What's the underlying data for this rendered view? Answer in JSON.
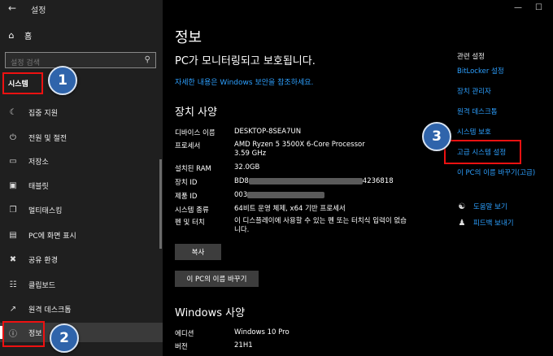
{
  "app": {
    "title": "설정",
    "back_icon": "back-arrow-icon"
  },
  "sidebar": {
    "home_label": "홈",
    "search_placeholder": "설정 검색",
    "section_label": "시스템",
    "items": [
      {
        "label": "집중 지원",
        "icon": "moon-icon"
      },
      {
        "label": "전원 및 절전",
        "icon": "power-icon"
      },
      {
        "label": "저장소",
        "icon": "storage-icon"
      },
      {
        "label": "태블릿",
        "icon": "tablet-icon"
      },
      {
        "label": "멀티태스킹",
        "icon": "multitasking-icon"
      },
      {
        "label": "PC에 화면 표시",
        "icon": "project-icon"
      },
      {
        "label": "공유 환경",
        "icon": "shared-experience-icon"
      },
      {
        "label": "클립보드",
        "icon": "clipboard-icon"
      },
      {
        "label": "원격 데스크톱",
        "icon": "remote-desktop-icon"
      },
      {
        "label": "정보",
        "icon": "info-icon"
      }
    ]
  },
  "annotations": {
    "badge1": "1",
    "badge2": "2",
    "badge3": "3"
  },
  "main": {
    "title": "정보",
    "status": "PC가 모니터링되고 보호됩니다.",
    "status_link": "자세한 내용은 Windows 보안을 참조하세요.",
    "device_spec_title": "장치 사양",
    "device_specs": [
      {
        "key": "디바이스 이름",
        "value": "DESKTOP-8SEA7UN"
      },
      {
        "key": "프로세서",
        "value": "AMD Ryzen 5 3500X 6-Core Processor 3.59 GHz"
      },
      {
        "key": "설치된 RAM",
        "value": "32.0GB"
      },
      {
        "key": "장치 ID",
        "value_prefix": "BD8",
        "value_suffix": "4236818"
      },
      {
        "key": "제품 ID",
        "value_prefix": "003"
      },
      {
        "key": "시스템 종류",
        "value": "64비트 운영 체제, x64 기반 프로세서"
      },
      {
        "key": "펜 및 터치",
        "value": "이 디스플레이에 사용할 수 있는 펜 또는 터치식 입력이 없습니다."
      }
    ],
    "copy_button": "복사",
    "rename_button": "이 PC의 이름 바꾸기",
    "windows_spec_title": "Windows 사양",
    "windows_specs": [
      {
        "key": "에디션",
        "value": "Windows 10 Pro"
      },
      {
        "key": "버전",
        "value": "21H1"
      }
    ]
  },
  "related": {
    "title": "관련 설정",
    "links": [
      "BitLocker 설정",
      "장치 관리자",
      "원격 데스크톱",
      "시스템 보호",
      "고급 시스템 설정",
      "이 PC의 이름 바꾸기(고급)"
    ],
    "help": "도움말 보기",
    "feedback": "피드백 보내기"
  },
  "colors": {
    "link": "#2da0ff",
    "annotation_red": "#e11111",
    "badge_blue": "#2f64ab"
  }
}
